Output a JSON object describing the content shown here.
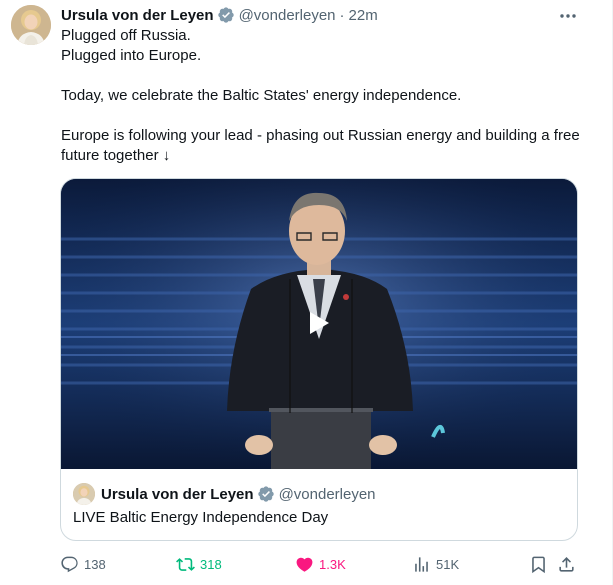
{
  "author": {
    "name": "Ursula von der Leyen",
    "handle": "@vonderleyen",
    "separator": "·",
    "time": "22m"
  },
  "tweet": {
    "lines": [
      "Plugged off Russia.",
      "Plugged into Europe.",
      "Today, we celebrate the Baltic States' energy independence.",
      "Europe is following your lead - phasing out Russian energy and building a free future together ↓"
    ]
  },
  "quoted": {
    "name": "Ursula von der Leyen",
    "handle": "@vonderleyen",
    "text": "LIVE Baltic Energy Independence Day"
  },
  "actions": {
    "replies": "138",
    "reposts": "318",
    "likes": "1.3K",
    "views": "51K"
  },
  "colors": {
    "repost": "#00ba7c",
    "like": "#f91880",
    "verified": "#829aab",
    "muted": "#536471"
  }
}
